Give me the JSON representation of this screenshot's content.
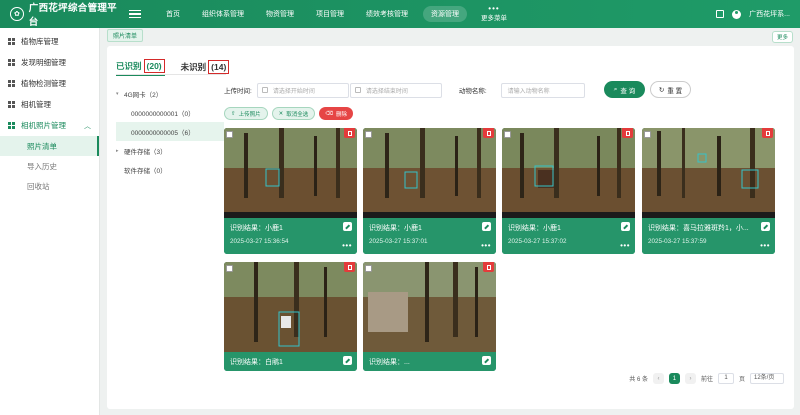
{
  "app": {
    "title": "广西花坪综合管理平台",
    "logo_glyph": "✿"
  },
  "nav": {
    "items": [
      "首页",
      "组织体系管理",
      "物资管理",
      "项目管理",
      "绩效考核管理",
      "资源管理"
    ],
    "active_index": 5,
    "more_label": "更多菜单",
    "user_label": "广西花坪系..."
  },
  "sidebar": {
    "items": [
      "植物库管理",
      "发现明细管理",
      "植物检测管理",
      "相机管理",
      "相机照片管理"
    ],
    "subitems": [
      "照片清单",
      "导入历史",
      "回收站"
    ]
  },
  "breadcrumb": {
    "tag": "照片清单",
    "more": "更多"
  },
  "tabs": {
    "recognized_label": "已识别",
    "recognized_count": "(20)",
    "unrecognized_label": "未识别",
    "unrecognized_count": "(14)"
  },
  "tree": [
    {
      "label": "4G网卡（2）",
      "level": 0,
      "caret": "▾"
    },
    {
      "label": "0000000000001（0）",
      "level": 1
    },
    {
      "label": "0000000000005（6）",
      "level": 1,
      "selected": true
    },
    {
      "label": "硬件存储（3）",
      "level": 0,
      "caret": "▸"
    },
    {
      "label": "软件存储（0）",
      "level": 0
    }
  ],
  "filters": {
    "upload_time_label": "上传时间:",
    "start_placeholder": "请选择开始时间",
    "end_placeholder": "请选择结束时间",
    "animal_label": "动物名称:",
    "animal_placeholder": "请输入动物名称",
    "query": "查 询",
    "reset": "重 置"
  },
  "actions": {
    "upload": "上传照片",
    "cancel_all": "取消全选",
    "delete": "删除"
  },
  "cards": [
    {
      "result": "识别结果：小鹿1",
      "time": "2025-03-27 15:36:54"
    },
    {
      "result": "识别结果：小鹿1",
      "time": "2025-03-27 15:37:01"
    },
    {
      "result": "识别结果：小鹿1",
      "time": "2025-03-27 15:37:02"
    },
    {
      "result": "识别结果：喜马拉雅斑羚1，小...",
      "time": "2025-03-27 15:37:59"
    },
    {
      "result": "识别结果：白鹇1",
      "time": ""
    },
    {
      "result": "识别结果：...",
      "time": ""
    }
  ],
  "pager": {
    "total": "共 6 条",
    "current": "1",
    "goto_label": "前往",
    "goto_value": "1",
    "page_unit": "页",
    "size": "12条/页"
  },
  "colors": {
    "primary": "#1a8a5c",
    "danger": "#e43b3b",
    "card": "#26956a"
  }
}
